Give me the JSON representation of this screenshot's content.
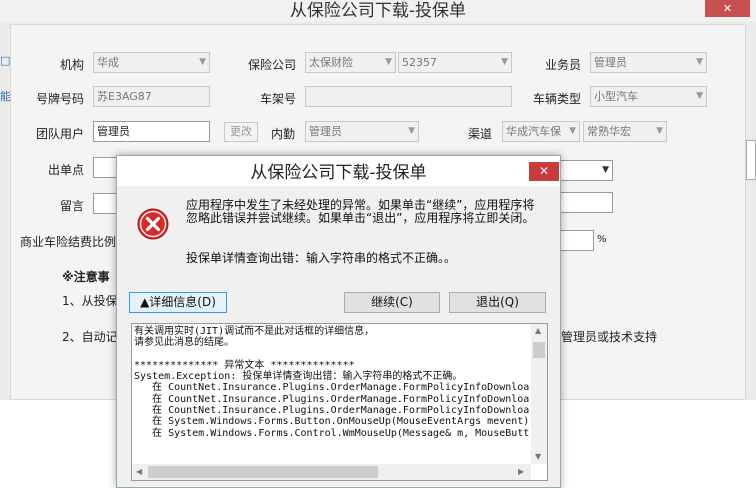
{
  "window": {
    "title": "从保险公司下载-投保单",
    "close_label": "✕"
  },
  "form": {
    "agency_label": "机构",
    "agency_value": "华成",
    "insurer_label": "保险公司",
    "insurer_value": "太保财险",
    "insurer_code": "52357",
    "salesman_label": "业务员",
    "salesman_value": "管理员",
    "plate_label": "号牌号码",
    "plate_value": "苏E3AG87",
    "frame_label": "车架号",
    "frame_value": "",
    "vehicle_type_label": "车辆类型",
    "vehicle_type_value": "小型汽车",
    "team_user_label": "团队用户",
    "team_user_value": "管理员",
    "change_button": "更改",
    "internal_label": "内勤",
    "internal_value": "管理员",
    "channel_label": "渠道",
    "channel_value": "华成汽车保",
    "channel_value2": "常熟华宏",
    "issue_point_label": "出单点",
    "message_label": "留言",
    "ratio_label": "商业车险结费比例",
    "percent_symbol": "%",
    "notes_title": "※注意事",
    "note1": "1、从投保",
    "note2": "2、自动记",
    "note2_tail": "管理员或技术支持"
  },
  "dialog": {
    "title": "从保险公司下载-投保单",
    "close_label": "✕",
    "message": "应用程序中发生了未经处理的异常。如果单击“继续”，应用程序将忽略此错误并尝试继续。如果单击“退出”，应用程序将立即关闭。",
    "detail_message": "投保单详情查询出错：输入字符串的格式不正确。。",
    "details_button": "▲详细信息(D)",
    "continue_button": "继续(C)",
    "quit_button": "退出(Q)",
    "detail_text": "有关调用实时(JIT)调试而不是此对话框的详细信息，\n请参见此消息的结尾。\n\n************** 异常文本 **************\nSystem.Exception: 投保单详情查询出错：输入字符串的格式不正确。\n   在 CountNet.Insurance.Plugins.OrderManage.FormPolicyInfoDownloa\n   在 CountNet.Insurance.Plugins.OrderManage.FormPolicyInfoDownloa\n   在 CountNet.Insurance.Plugins.OrderManage.FormPolicyInfoDownloa\n   在 System.Windows.Forms.Button.OnMouseUp(MouseEventArgs mevent)\n   在 System.Windows.Forms.Control.WmMouseUp(Message& m, MouseButt"
  },
  "colors": {
    "close_red": "#c83c3c",
    "error_icon": "#d32a2a",
    "focus_blue": "#3399ff"
  },
  "icons": {
    "error": "error-x-icon",
    "dropdown": "chevron-down-icon"
  }
}
